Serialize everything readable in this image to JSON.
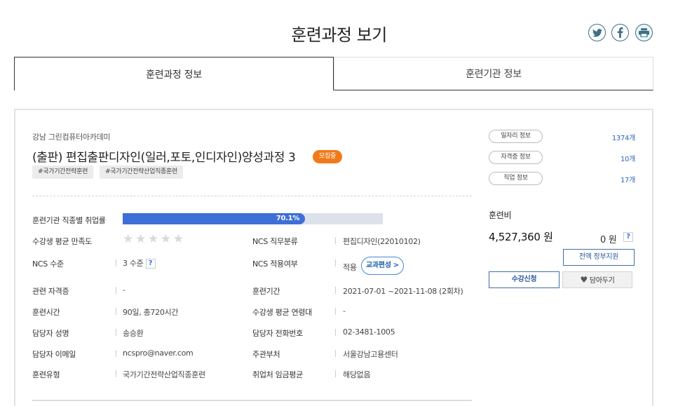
{
  "page_title": "훈련과정 보기",
  "share": {
    "twitter": "twitter-icon",
    "facebook": "facebook-icon",
    "print": "print-icon"
  },
  "tabs": [
    {
      "label": "훈련과정 정보",
      "active": true
    },
    {
      "label": "훈련기관 정보",
      "active": false
    }
  ],
  "course": {
    "academy": "강남 그린컴퓨터아카데미",
    "title": "(출판) 편집출판디자인(일러,포토,인디자인)양성과정 3",
    "status_badge": "모집중",
    "tags": [
      "#국가기간전략훈련",
      "#국가기간전략산업직종훈련"
    ]
  },
  "employment_rate": {
    "label": "훈련기관 직종별 취업률",
    "value_text": "70.1%",
    "value": 70.1
  },
  "satisfaction": {
    "label": "수강생 평균 만족도",
    "stars_filled": 0,
    "stars_total": 5
  },
  "details": {
    "ncs_category_label": "NCS 직무분류",
    "ncs_category": "편집디자인(22010102)",
    "ncs_level_label": "NCS 수준",
    "ncs_level": "3 수준",
    "ncs_applied_label": "NCS 적용여부",
    "ncs_applied": "적용",
    "curriculum_button": "교과편성 >",
    "cert_label": "관련 자격증",
    "cert": "-",
    "period_label": "훈련기간",
    "period": "2021-07-01 ~2021-11-08 (2회차)",
    "hours_label": "훈련시간",
    "hours": "90일, 총720시간",
    "age_label": "수강생 평균 연령대",
    "age": "-",
    "manager_label": "담당자 성명",
    "manager": "송승환",
    "phone_label": "담당자 전화번호",
    "phone": "02-3481-1005",
    "email_label": "담당자 이메일",
    "email": "ncspro@naver.com",
    "dept_label": "주관부처",
    "dept": "서울강남고용센터",
    "type_label": "훈련유형",
    "type": "국가기간전략산업직종훈련",
    "wage_label": "취업처 임금평균",
    "wage": "해당없음"
  },
  "side_info": [
    {
      "label": "일자리 정보",
      "count": "1374개"
    },
    {
      "label": "자격증 정보",
      "count": "10개"
    },
    {
      "label": "직업 정보",
      "count": "17개"
    }
  ],
  "fee": {
    "label": "훈련비",
    "amount": "4,527,360 원",
    "self_pay": "0 원",
    "help": "?",
    "gov_support_button": "전액 정부지원"
  },
  "actions": {
    "apply": "수강신청",
    "wishlist": "담아두기"
  }
}
